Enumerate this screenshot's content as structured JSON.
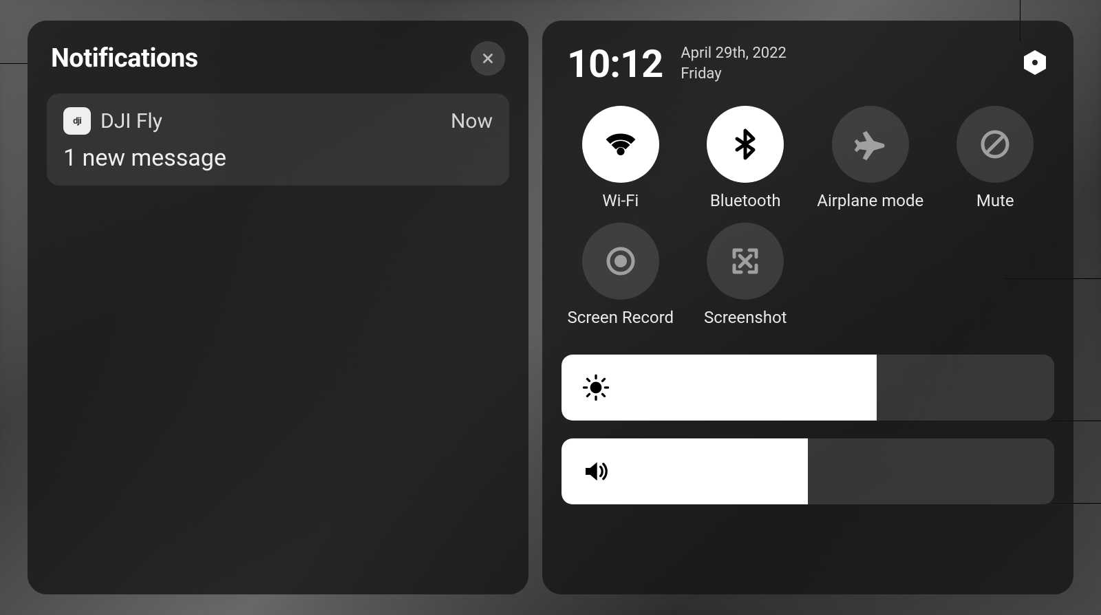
{
  "notifications": {
    "title": "Notifications",
    "items": [
      {
        "app_icon_text": "dji",
        "app_name": "DJI Fly",
        "time": "Now",
        "body": "1 new message"
      }
    ]
  },
  "quick_settings": {
    "clock": {
      "time": "10:12",
      "date_line1": "April 29th, 2022",
      "date_line2": "Friday"
    },
    "toggles": [
      {
        "id": "wifi",
        "label": "Wi-Fi",
        "active": true,
        "icon": "wifi-icon"
      },
      {
        "id": "bluetooth",
        "label": "Bluetooth",
        "active": true,
        "icon": "bluetooth-icon"
      },
      {
        "id": "airplane",
        "label": "Airplane mode",
        "active": false,
        "icon": "airplane-icon"
      },
      {
        "id": "mute",
        "label": "Mute",
        "active": false,
        "icon": "mute-icon"
      },
      {
        "id": "screenrecord",
        "label": "Screen Record",
        "active": false,
        "icon": "record-icon"
      },
      {
        "id": "screenshot",
        "label": "Screenshot",
        "active": false,
        "icon": "screenshot-icon"
      }
    ],
    "sliders": {
      "brightness": {
        "percent": 64
      },
      "volume": {
        "percent": 50
      }
    }
  }
}
